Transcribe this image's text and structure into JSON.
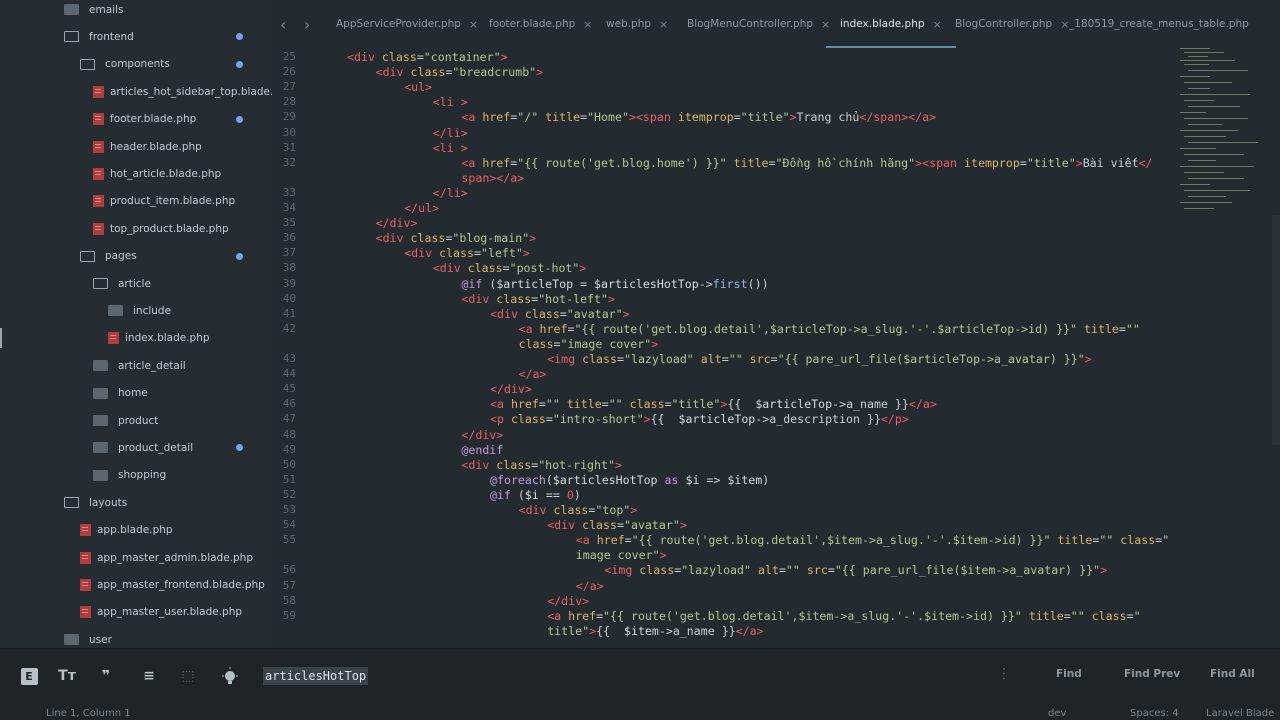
{
  "sidebar": {
    "items": [
      {
        "label": "emails",
        "kind": "folder-closed",
        "indent": 1,
        "dot": false
      },
      {
        "label": "frontend",
        "kind": "folder-open",
        "indent": 1,
        "dot": true
      },
      {
        "label": "components",
        "kind": "folder-open",
        "indent": 2,
        "dot": true
      },
      {
        "label": "articles_hot_sidebar_top.blade.php",
        "kind": "file",
        "indent": 3,
        "dot": false
      },
      {
        "label": "footer.blade.php",
        "kind": "file",
        "indent": 3,
        "dot": true
      },
      {
        "label": "header.blade.php",
        "kind": "file",
        "indent": 3,
        "dot": false
      },
      {
        "label": "hot_article.blade.php",
        "kind": "file",
        "indent": 3,
        "dot": false
      },
      {
        "label": "product_item.blade.php",
        "kind": "file",
        "indent": 3,
        "dot": false
      },
      {
        "label": "top_product.blade.php",
        "kind": "file",
        "indent": 3,
        "dot": false
      },
      {
        "label": "pages",
        "kind": "folder-open",
        "indent": 2,
        "dot": true
      },
      {
        "label": "article",
        "kind": "folder-open",
        "indent": 3,
        "dot": false
      },
      {
        "label": "include",
        "kind": "folder-closed",
        "indent": 4,
        "dot": false
      },
      {
        "label": "index.blade.php",
        "kind": "file",
        "indent": 4,
        "dot": false
      },
      {
        "label": "article_detail",
        "kind": "folder-closed",
        "indent": 3,
        "dot": false
      },
      {
        "label": "home",
        "kind": "folder-closed",
        "indent": 3,
        "dot": false
      },
      {
        "label": "product",
        "kind": "folder-closed",
        "indent": 3,
        "dot": false
      },
      {
        "label": "product_detail",
        "kind": "folder-closed",
        "indent": 3,
        "dot": true
      },
      {
        "label": "shopping",
        "kind": "folder-closed",
        "indent": 3,
        "dot": false
      },
      {
        "label": "layouts",
        "kind": "folder-open",
        "indent": 1,
        "dot": false
      },
      {
        "label": "app.blade.php",
        "kind": "file",
        "indent": 2,
        "dot": false
      },
      {
        "label": "app_master_admin.blade.php",
        "kind": "file",
        "indent": 2,
        "dot": false
      },
      {
        "label": "app_master_frontend.blade.php",
        "kind": "file",
        "indent": 2,
        "dot": false
      },
      {
        "label": "app_master_user.blade.php",
        "kind": "file",
        "indent": 2,
        "dot": false
      },
      {
        "label": "user",
        "kind": "folder-closed",
        "indent": 1,
        "dot": false
      }
    ]
  },
  "tabs": [
    {
      "label": "AppServiceProvider.php",
      "active": false
    },
    {
      "label": "footer.blade.php",
      "active": false
    },
    {
      "label": "web.php",
      "active": false
    },
    {
      "label": "BlogMenuController.php",
      "active": false
    },
    {
      "label": "index.blade.php",
      "active": true
    },
    {
      "label": "BlogController.php",
      "active": false
    },
    {
      "label": "_180519_create_menus_table.php",
      "active": false
    }
  ],
  "editor": {
    "lines": [
      {
        "n": "25",
        "indent": 1,
        "html": "<span class=\"tag\">&lt;div</span> <span class=\"attr\">class</span>=<span class=\"str\">\"container\"</span><span class=\"tag\">&gt;</span>"
      },
      {
        "n": "26",
        "indent": 2,
        "html": "<span class=\"tag\">&lt;div</span> <span class=\"attr\">class</span>=<span class=\"str\">\"breadcrumb\"</span><span class=\"tag\">&gt;</span>"
      },
      {
        "n": "27",
        "indent": 3,
        "html": "<span class=\"tag\">&lt;ul&gt;</span>"
      },
      {
        "n": "28",
        "indent": 4,
        "html": "<span class=\"tag\">&lt;li</span> <span class=\"tag\">&gt;</span>"
      },
      {
        "n": "29",
        "indent": 5,
        "html": "<span class=\"tag\">&lt;a</span> <span class=\"attr\">href</span>=<span class=\"str\">\"/\"</span> <span class=\"attr\">title</span>=<span class=\"str\">\"Home\"</span><span class=\"tag\">&gt;&lt;span</span> <span class=\"attr\">itemprop</span>=<span class=\"str\">\"title\"</span><span class=\"tag\">&gt;</span>Trang chủ<span class=\"tag\">&lt;/span&gt;&lt;/a&gt;</span>"
      },
      {
        "n": "30",
        "indent": 4,
        "html": "<span class=\"tag\">&lt;/li&gt;</span>"
      },
      {
        "n": "31",
        "indent": 4,
        "html": "<span class=\"tag\">&lt;li</span> <span class=\"tag\">&gt;</span>"
      },
      {
        "n": "32",
        "indent": 5,
        "html": "<span class=\"tag\">&lt;a</span> <span class=\"attr\">href</span>=<span class=\"str\">\"{{ route('get.blog.home') }}\"</span> <span class=\"attr\">title</span>=<span class=\"str\">\"Đồng hồ chính hãng\"</span><span class=\"tag\">&gt;&lt;span</span> <span class=\"attr\">itemprop</span>=<span class=\"str\">\"title\"</span><span class=\"tag\">&gt;</span>Bài viết<span class=\"tag\">&lt;/</span>"
      },
      {
        "n": "",
        "indent": 5,
        "html": "<span class=\"tag\">span&gt;&lt;/a&gt;</span>"
      },
      {
        "n": "33",
        "indent": 4,
        "html": "<span class=\"tag\">&lt;/li&gt;</span>"
      },
      {
        "n": "34",
        "indent": 3,
        "html": "<span class=\"tag\">&lt;/ul&gt;</span>"
      },
      {
        "n": "35",
        "indent": 2,
        "html": "<span class=\"tag\">&lt;/div&gt;</span>"
      },
      {
        "n": "36",
        "indent": 2,
        "html": "<span class=\"tag\">&lt;div</span> <span class=\"attr\">class</span>=<span class=\"str\">\"blog-main\"</span><span class=\"tag\">&gt;</span>"
      },
      {
        "n": "37",
        "indent": 3,
        "html": "<span class=\"tag\">&lt;div</span> <span class=\"attr\">class</span>=<span class=\"str\">\"left\"</span><span class=\"tag\">&gt;</span>"
      },
      {
        "n": "38",
        "indent": 4,
        "html": "<span class=\"tag\">&lt;div</span> <span class=\"attr\">class</span>=<span class=\"str\">\"post-hot\"</span><span class=\"tag\">&gt;</span>"
      },
      {
        "n": "39",
        "indent": 5,
        "html": "<span class=\"kw\">@if</span> (<span class=\"var\">$articleTop</span> = <span class=\"var\">$articlesHotTop</span>-&gt;<span class=\"fn\">first</span>())"
      },
      {
        "n": "40",
        "indent": 5,
        "html": "<span class=\"tag\">&lt;div</span> <span class=\"attr\">class</span>=<span class=\"str\">\"hot-left\"</span><span class=\"tag\">&gt;</span>"
      },
      {
        "n": "41",
        "indent": 6,
        "html": "<span class=\"tag\">&lt;div</span> <span class=\"attr\">class</span>=<span class=\"str\">\"avatar\"</span><span class=\"tag\">&gt;</span>"
      },
      {
        "n": "42",
        "indent": 7,
        "html": "<span class=\"tag\">&lt;a</span> <span class=\"attr\">href</span>=<span class=\"str\">\"{{ route('get.blog.detail',$articleTop-&gt;a_slug.'-'.$articleTop-&gt;id) }}\"</span> <span class=\"attr\">title</span>=<span class=\"str\">\"\"</span>"
      },
      {
        "n": "",
        "indent": 7,
        "html": "<span class=\"attr\">class</span>=<span class=\"str\">\"image cover\"</span><span class=\"tag\">&gt;</span>"
      },
      {
        "n": "43",
        "indent": 8,
        "html": "<span class=\"tag\">&lt;img</span> <span class=\"attr\">class</span>=<span class=\"str\">\"lazyload\"</span> <span class=\"attr\">alt</span>=<span class=\"str\">\"\"</span> <span class=\"attr\">src</span>=<span class=\"str\">\"{{ pare_url_file($articleTop-&gt;a_avatar) }}\"</span><span class=\"tag\">&gt;</span>"
      },
      {
        "n": "44",
        "indent": 7,
        "html": "<span class=\"tag\">&lt;/a&gt;</span>"
      },
      {
        "n": "45",
        "indent": 6,
        "html": "<span class=\"tag\">&lt;/div&gt;</span>"
      },
      {
        "n": "46",
        "indent": 6,
        "html": "<span class=\"tag\">&lt;a</span> <span class=\"attr\">href</span>=<span class=\"str\">\"\"</span> <span class=\"attr\">title</span>=<span class=\"str\">\"\"</span> <span class=\"attr\">class</span>=<span class=\"str\">\"title\"</span><span class=\"tag\">&gt;</span>{{  <span class=\"var\">$articleTop</span>-&gt;a_name }}<span class=\"tag\">&lt;/a&gt;</span>"
      },
      {
        "n": "47",
        "indent": 6,
        "html": "<span class=\"tag\">&lt;p</span> <span class=\"attr\">class</span>=<span class=\"str\">\"intro-short\"</span><span class=\"tag\">&gt;</span>{{  <span class=\"var\">$articleTop</span>-&gt;a_description }}<span class=\"tag\">&lt;/p&gt;</span>"
      },
      {
        "n": "48",
        "indent": 5,
        "html": "<span class=\"tag\">&lt;/div&gt;</span>"
      },
      {
        "n": "49",
        "indent": 5,
        "html": "<span class=\"kw\">@endif</span>"
      },
      {
        "n": "50",
        "indent": 5,
        "html": "<span class=\"tag\">&lt;div</span> <span class=\"attr\">class</span>=<span class=\"str\">\"hot-right\"</span><span class=\"tag\">&gt;</span>"
      },
      {
        "n": "51",
        "indent": 6,
        "html": "<span class=\"kw\">@foreach</span>(<span class=\"var\">$articlesHotTop</span> <span class=\"kw\">as</span> <span class=\"var\">$i</span> =&gt; <span class=\"var\">$item</span>)"
      },
      {
        "n": "52",
        "indent": 6,
        "html": "<span class=\"kw\">@if</span> (<span class=\"var\">$i</span> == <span class=\"tag\">0</span>)"
      },
      {
        "n": "53",
        "indent": 7,
        "html": "<span class=\"tag\">&lt;div</span> <span class=\"attr\">class</span>=<span class=\"str\">\"top\"</span><span class=\"tag\">&gt;</span>"
      },
      {
        "n": "54",
        "indent": 8,
        "html": "<span class=\"tag\">&lt;div</span> <span class=\"attr\">class</span>=<span class=\"str\">\"avatar\"</span><span class=\"tag\">&gt;</span>"
      },
      {
        "n": "55",
        "indent": 9,
        "html": "<span class=\"tag\">&lt;a</span> <span class=\"attr\">href</span>=<span class=\"str\">\"{{ route('get.blog.detail',$item-&gt;a_slug.'-'.$item-&gt;id) }}\"</span> <span class=\"attr\">title</span>=<span class=\"str\">\"\"</span> <span class=\"attr\">class</span>=<span class=\"str\">\"</span>"
      },
      {
        "n": "",
        "indent": 9,
        "html": "<span class=\"str\">image cover\"</span><span class=\"tag\">&gt;</span>"
      },
      {
        "n": "56",
        "indent": 10,
        "html": "<span class=\"tag\">&lt;img</span> <span class=\"attr\">class</span>=<span class=\"str\">\"lazyload\"</span> <span class=\"attr\">alt</span>=<span class=\"str\">\"\"</span> <span class=\"attr\">src</span>=<span class=\"str\">\"{{ pare_url_file($item-&gt;a_avatar) }}\"</span><span class=\"tag\">&gt;</span>"
      },
      {
        "n": "57",
        "indent": 9,
        "html": "<span class=\"tag\">&lt;/a&gt;</span>"
      },
      {
        "n": "58",
        "indent": 8,
        "html": "<span class=\"tag\">&lt;/div&gt;</span>"
      },
      {
        "n": "59",
        "indent": 8,
        "html": "<span class=\"tag\">&lt;a</span> <span class=\"attr\">href</span>=<span class=\"str\">\"{{ route('get.blog.detail',$item-&gt;a_slug.'-'.$item-&gt;id) }}\"</span> <span class=\"attr\">title</span>=<span class=\"str\">\"\"</span> <span class=\"attr\">class</span>=<span class=\"str\">\"</span>"
      },
      {
        "n": "",
        "indent": 8,
        "html": "<span class=\"str\">title\"</span><span class=\"tag\">&gt;</span>{{  <span class=\"var\">$item</span>-&gt;a_name }}<span class=\"tag\">&lt;/a&gt;</span>"
      }
    ]
  },
  "findbar": {
    "query": "articlesHotTop",
    "find_label": "Find",
    "find_prev_label": "Find Prev",
    "find_all_label": "Find All",
    "icons": [
      "regex-icon",
      "case-sensitive-icon",
      "whole-word-icon",
      "wrap-icon",
      "in-selection-icon",
      "highlight-icon"
    ]
  },
  "statusbar": {
    "position": "Line 1, Column 1",
    "branch": "dev",
    "indent": "Spaces: 4",
    "syntax": "Laravel Blade"
  },
  "colors": {
    "background": "#232a30",
    "sidebar": "#252c32",
    "tag": "#e86161",
    "attribute": "#d9b566",
    "string": "#b3c88f",
    "keyword": "#c59ae0",
    "modified_dot": "#7aa0ee",
    "active_tab_underline": "#5d8fb0"
  }
}
